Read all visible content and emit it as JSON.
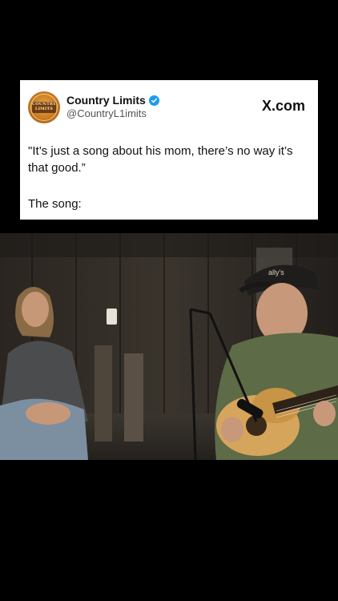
{
  "post": {
    "author_name": "Country Limits",
    "author_handle": "@CountryL1imits",
    "avatar_text": "COUNTRY LIMITS",
    "source": "X.com",
    "text": "\"It’s just a song about his mom, there’s no way it’s that good.”",
    "subtext": "The song:",
    "verified_color": "#1d9bf0"
  },
  "video": {
    "cap_text": "ally's"
  }
}
